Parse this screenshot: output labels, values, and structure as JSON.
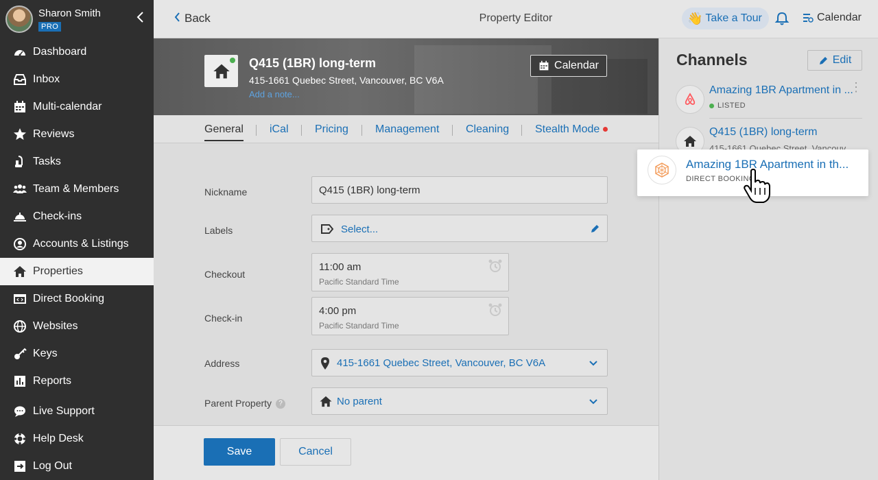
{
  "user": {
    "name": "Sharon Smith",
    "badge": "PRO"
  },
  "sidebar": {
    "items": [
      {
        "label": "Dashboard",
        "icon": "dashboard-icon"
      },
      {
        "label": "Inbox",
        "icon": "inbox-icon"
      },
      {
        "label": "Multi-calendar",
        "icon": "calendar-icon"
      },
      {
        "label": "Reviews",
        "icon": "star-icon"
      },
      {
        "label": "Tasks",
        "icon": "vacuum-icon"
      },
      {
        "label": "Team & Members",
        "icon": "team-icon"
      },
      {
        "label": "Check-ins",
        "icon": "bell-service-icon"
      },
      {
        "label": "Accounts & Listings",
        "icon": "account-icon"
      },
      {
        "label": "Properties",
        "icon": "home-icon",
        "active": true
      },
      {
        "label": "Direct Booking",
        "icon": "code-window-icon"
      },
      {
        "label": "Websites",
        "icon": "globe-icon"
      },
      {
        "label": "Keys",
        "icon": "key-icon"
      },
      {
        "label": "Reports",
        "icon": "chart-icon"
      }
    ],
    "bottom": [
      {
        "label": "Live Support",
        "icon": "chat-icon"
      },
      {
        "label": "Help Desk",
        "icon": "lifebuoy-icon"
      },
      {
        "label": "Log Out",
        "icon": "logout-icon"
      }
    ]
  },
  "topbar": {
    "back_label": "Back",
    "title": "Property Editor",
    "tour_label": "Take a Tour",
    "calendar_label": "Calendar"
  },
  "property": {
    "title": "Q415 (1BR) long-term",
    "address": "415-1661 Quebec Street, Vancouver, BC V6A",
    "add_note": "Add a note...",
    "calendar_button": "Calendar"
  },
  "tabs": [
    "General",
    "iCal",
    "Pricing",
    "Management",
    "Cleaning",
    "Stealth Mode"
  ],
  "form": {
    "nickname_label": "Nickname",
    "nickname_value": "Q415 (1BR) long-term",
    "labels_label": "Labels",
    "labels_placeholder": "Select...",
    "checkout_label": "Checkout",
    "checkout_time": "11:00 am",
    "checkout_tz": "Pacific Standard Time",
    "checkin_label": "Check-in",
    "checkin_time": "4:00 pm",
    "checkin_tz": "Pacific Standard Time",
    "address_label": "Address",
    "address_value": "415-1661 Quebec Street, Vancouver, BC V6A",
    "parent_label": "Parent Property",
    "parent_value": "No parent",
    "help_mark": "?"
  },
  "footer": {
    "save_label": "Save",
    "cancel_label": "Cancel"
  },
  "channels": {
    "title": "Channels",
    "edit_label": "Edit",
    "items": [
      {
        "name": "Amazing 1BR Apartment in ...",
        "status": "LISTED",
        "logo": "airbnb-icon"
      },
      {
        "name": "Q415 (1BR) long-term",
        "address": "415-1661 Quebec Street, Vancouv",
        "logo": "home-icon"
      },
      {
        "name": "Amazing 1BR Apartment in th...",
        "status": "DIRECT BOOKING",
        "logo": "direct-booking-icon"
      }
    ]
  },
  "colors": {
    "accent": "#1a6fb5",
    "sidebar_bg": "#2f2f2f",
    "airbnb": "#ff5a5f",
    "direct": "#f39c5a"
  }
}
